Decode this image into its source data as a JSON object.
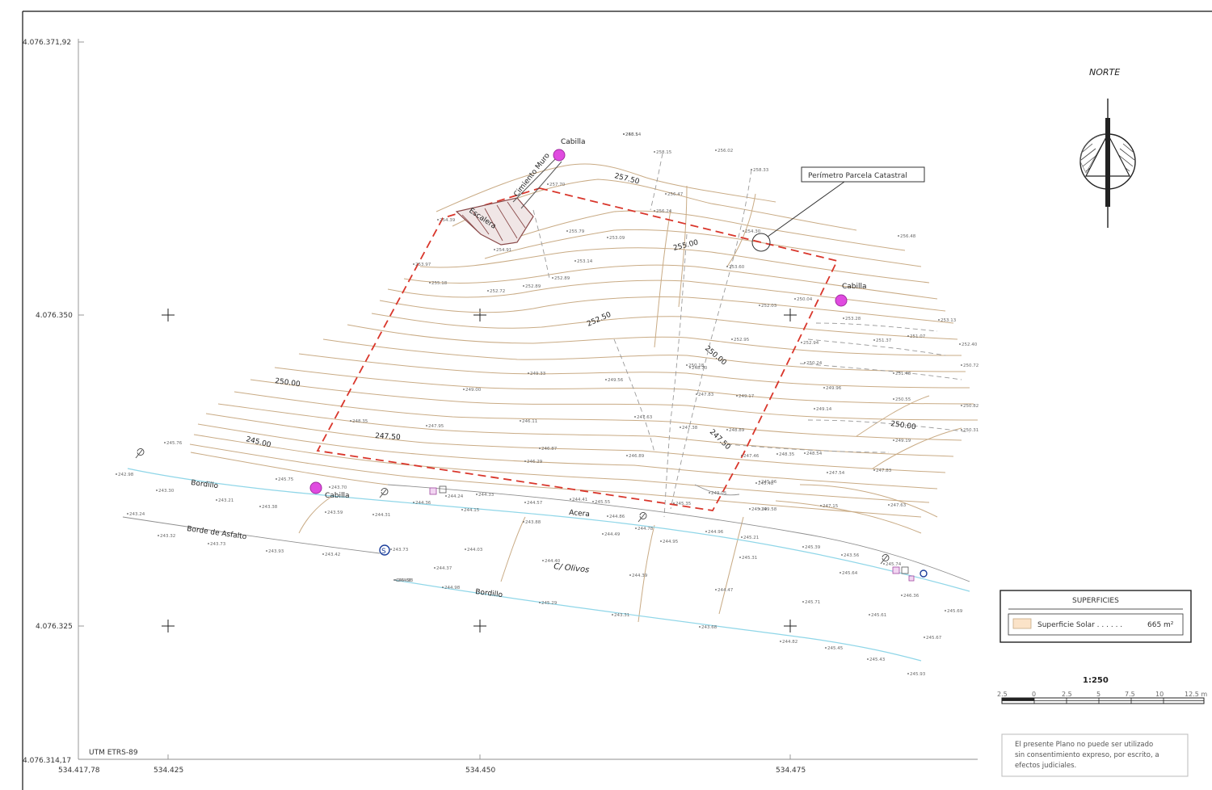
{
  "axes": {
    "y_labels": [
      "4.076.371,92",
      "4.076.350",
      "4.076.325",
      "4.076.314,17"
    ],
    "x_labels": [
      "534.417,78",
      "534.425",
      "534.450",
      "534.475"
    ],
    "crs": "UTM ETRS-89"
  },
  "north": {
    "label": "NORTE"
  },
  "callout": {
    "label": "Perímetro Parcela Catastral"
  },
  "places": {
    "cabilla_top": "Cabilla",
    "cabilla_right": "Cabilla",
    "cabilla_left": "Cabilla",
    "escalera": "Escalera",
    "cimiento_muro": "Cimiento Muro",
    "bordillo_top": "Bordillo",
    "bordillo_bottom": "Bordillo",
    "borde_asfalto": "Borde de Asfalto",
    "acera": "Acera",
    "street": "C/ Olivos"
  },
  "contours": [
    "257.50",
    "255.00",
    "252.50",
    "250.00",
    "250.00",
    "250.00",
    "247.50",
    "247.50",
    "245.00"
  ],
  "spot_heights": [
    "256.14",
    "258.15",
    "256.02",
    "257.70",
    "258.33",
    "256.47",
    "256.24",
    "254.39",
    "255.79",
    "253.09",
    "254.91",
    "253.14",
    "252.89",
    "253.97",
    "252.72",
    "252.89",
    "255.18",
    "254.30",
    "253.60",
    "256.48",
    "253.28",
    "250.04",
    "252.03",
    "252.94",
    "253.13",
    "252.40",
    "251.07",
    "251.37",
    "250.24",
    "251.48",
    "250.72",
    "250.55",
    "249.96",
    "249.14",
    "250.31",
    "250.82",
    "249.19",
    "252.95",
    "250.18",
    "249.33",
    "249.00",
    "249.56",
    "248.70",
    "249.17",
    "247.63",
    "247.38",
    "247.83",
    "248.89",
    "249.05",
    "249.58",
    "248.35",
    "247.95",
    "246.11",
    "246.87",
    "246.29",
    "246.89",
    "247.46",
    "248.35",
    "248.54",
    "247.54",
    "247.83",
    "245.96",
    "245.75",
    "243.70",
    "243.59",
    "244.31",
    "244.36",
    "244.24",
    "244.33",
    "244.15",
    "244.57",
    "244.41",
    "245.55",
    "244.86",
    "245.35",
    "245.39",
    "245.48",
    "247.15",
    "247.63",
    "243.88",
    "244.49",
    "244.78",
    "244.95",
    "244.96",
    "245.21",
    "245.31",
    "245.39",
    "243.56",
    "245.64",
    "245.68",
    "243.30",
    "243.21",
    "243.38",
    "243.24",
    "243.32",
    "243.73",
    "243.93",
    "243.42",
    "243.73",
    "244.03",
    "244.37",
    "244.40",
    "244.39",
    "244.47",
    "244.93",
    "244.98",
    "245.29",
    "243.31",
    "243.68",
    "244.82",
    "245.45",
    "245.43",
    "245.93",
    "245.61",
    "245.67",
    "245.71",
    "245.74",
    "246.36",
    "245.69",
    "245.76",
    "242.98",
    "243.5"
  ],
  "legend": {
    "title": "SUPERFICIES",
    "item_label": "Superficie Solar . . . . . .",
    "item_value": "665 m²",
    "swatch_color": "#fbe3c8"
  },
  "scale": {
    "label": "1:250",
    "ticks": [
      "2.5",
      "0",
      "2.5",
      "5",
      "7.5",
      "10",
      "12.5 m"
    ]
  },
  "disclaimer": {
    "line1": "El presente Plano no puede ser utilizado",
    "line2": "sin consentimiento expreso, por escrito, a",
    "line3": "efectos judiciales."
  },
  "colors": {
    "contour": "#c9ab85",
    "plot_boundary": "#d9362b",
    "road_edge": "#8fd6e8",
    "benchmark": "#e04be0"
  }
}
